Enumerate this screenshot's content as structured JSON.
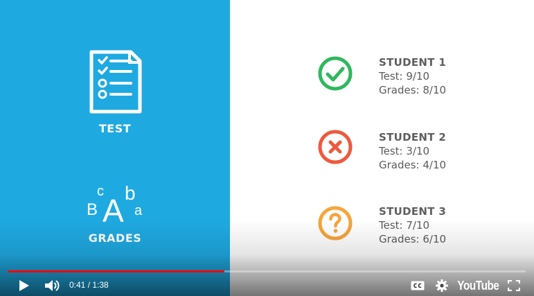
{
  "left_panel": {
    "test_label": "TEST",
    "grades_label": "GRADES",
    "grades_letters": [
      "B",
      "c",
      "A",
      "b",
      "a"
    ]
  },
  "students": [
    {
      "name": "STUDENT 1",
      "test": "Test: 9/10",
      "grades": "Grades: 8/10",
      "status_icon": "check-icon",
      "color": "#2fb85e"
    },
    {
      "name": "STUDENT 2",
      "test": "Test: 3/10",
      "grades": "Grades: 4/10",
      "status_icon": "x-icon",
      "color": "#ec5a3e"
    },
    {
      "name": "STUDENT 3",
      "test": "Test: 7/10",
      "grades": "Grades: 6/10",
      "status_icon": "question-icon",
      "color": "#f5a53c"
    }
  ],
  "player": {
    "current_time": "0:41",
    "separator": " / ",
    "duration": "1:38",
    "played_fraction": 0.418,
    "loaded_fraction": 0.418,
    "youtube_label": "YouTube",
    "progress_color": "#ff0000"
  },
  "colors": {
    "left_panel": "#1fa9e1"
  }
}
